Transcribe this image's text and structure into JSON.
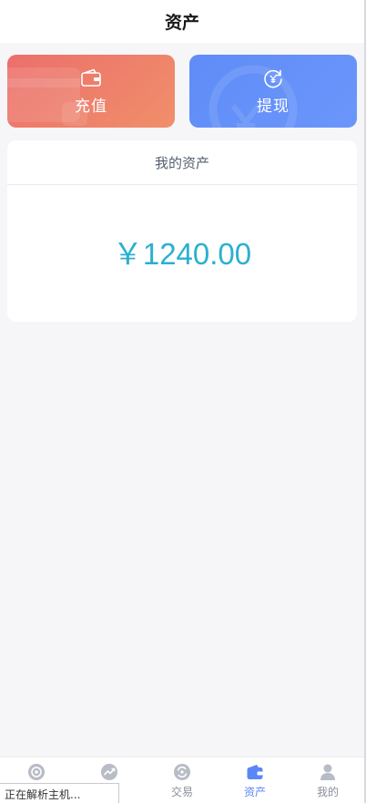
{
  "header": {
    "title": "资产"
  },
  "actions": {
    "recharge": {
      "label": "充值",
      "icon": "wallet-icon",
      "color": "#ec6f6c"
    },
    "withdraw": {
      "label": "提现",
      "icon": "yuan-refresh-icon",
      "color": "#5f8cf7"
    }
  },
  "assets_card": {
    "title": "我的资产",
    "amount": "￥1240.00",
    "amount_color": "#2bb0cf"
  },
  "tabbar": {
    "items": [
      {
        "label": "",
        "icon": "home-target-icon",
        "active": false
      },
      {
        "label": "",
        "icon": "trend-icon",
        "active": false
      },
      {
        "label": "交易",
        "icon": "exchange-icon",
        "active": false
      },
      {
        "label": "资产",
        "icon": "wallet-icon",
        "active": true
      },
      {
        "label": "我的",
        "icon": "user-icon",
        "active": false
      }
    ],
    "active_color": "#5a87f5"
  },
  "status_toast": {
    "text": "正在解析主机..."
  }
}
